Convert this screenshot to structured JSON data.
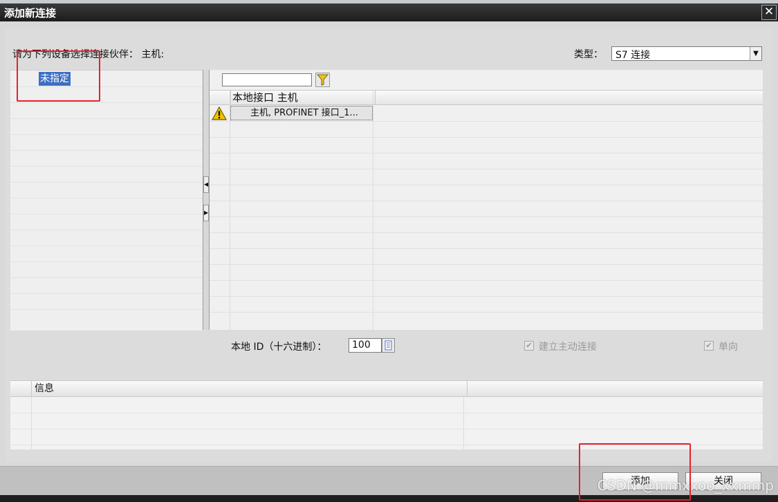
{
  "dialog": {
    "title": "添加新连接",
    "close_glyph": "✕"
  },
  "prompt": {
    "label": "请为下列设备选择连接伙伴： 主机:"
  },
  "connection_type": {
    "label": "类型：",
    "selected": "S7 连接"
  },
  "partner_list": {
    "items": [
      {
        "label": "未指定",
        "selected": true
      }
    ]
  },
  "interface_table": {
    "filter_value": "",
    "column_header": "本地接口 主机",
    "rows": [
      {
        "status_icon": "warning-icon",
        "interface": "主机, PROFINET 接口_1..."
      }
    ]
  },
  "local_id": {
    "label": "本地 ID（十六进制）：",
    "value": "100"
  },
  "options": {
    "active_connection": {
      "label": "建立主动连接",
      "checked": true,
      "enabled": false
    },
    "one_way": {
      "label": "单向",
      "checked": true,
      "enabled": false
    }
  },
  "info_table": {
    "column_header": "信息"
  },
  "footer": {
    "add_label": "添加",
    "close_label": "关闭"
  },
  "watermark": "CSDN @mmxxoo_xxmmp",
  "colors": {
    "selection": "#3d6fc4",
    "highlight_box": "#e8202a",
    "warning": "#f2c200"
  }
}
